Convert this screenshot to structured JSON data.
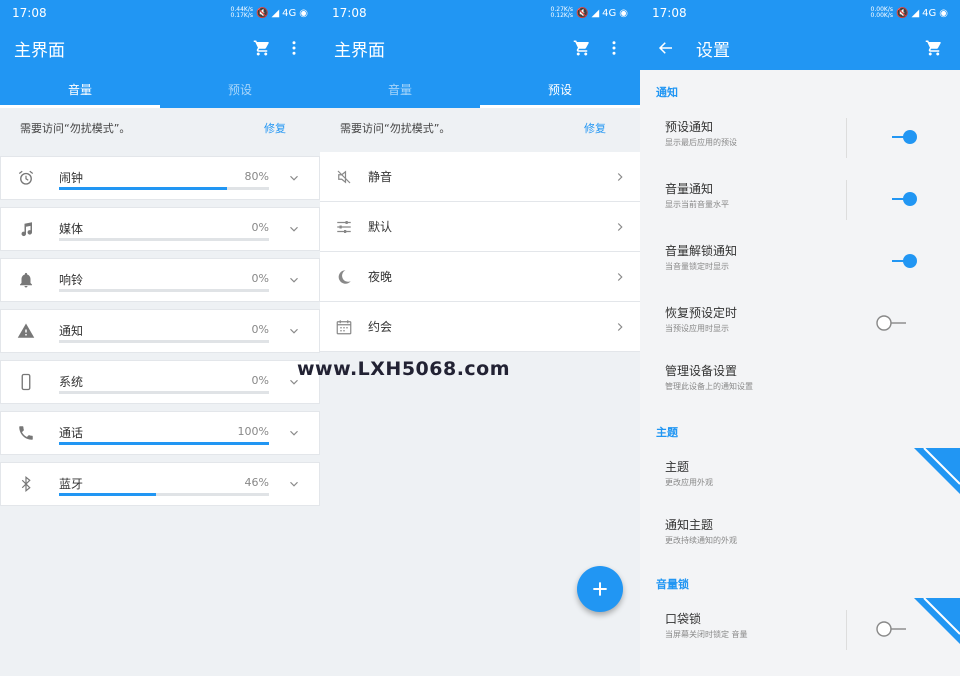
{
  "status": {
    "time": "17:08",
    "net_up": "0.44K/s",
    "net_down": "0.17K/s",
    "net_up_2": "0.27K/s",
    "net_down_2": "0.12K/s",
    "net_up_3": "0.00K/s",
    "net_down_3": "0.00K/s",
    "network": "4G"
  },
  "main": {
    "title": "主界面",
    "tabs": [
      {
        "label": "音量"
      },
      {
        "label": "预设"
      }
    ],
    "notice": "需要访问“勿扰模式”。",
    "fix_label": "修复",
    "volumes": [
      {
        "label": "闹钟",
        "percent": "80%",
        "level": 0.8,
        "icon": "alarm-clock-icon"
      },
      {
        "label": "媒体",
        "percent": "0%",
        "level": 0,
        "icon": "music-note-icon"
      },
      {
        "label": "响铃",
        "percent": "0%",
        "level": 0,
        "icon": "bell-icon"
      },
      {
        "label": "通知",
        "percent": "0%",
        "level": 0,
        "icon": "warning-icon"
      },
      {
        "label": "系统",
        "percent": "0%",
        "level": 0,
        "icon": "phone-device-icon"
      },
      {
        "label": "通话",
        "percent": "100%",
        "level": 1.0,
        "icon": "phone-call-icon"
      },
      {
        "label": "蓝牙",
        "percent": "46%",
        "level": 0.46,
        "icon": "bluetooth-icon"
      }
    ],
    "presets": [
      {
        "label": "静音",
        "icon": "mute-icon"
      },
      {
        "label": "默认",
        "icon": "sliders-icon"
      },
      {
        "label": "夜晚",
        "icon": "moon-icon"
      },
      {
        "label": "约会",
        "icon": "calendar-icon"
      }
    ]
  },
  "settings": {
    "title": "设置",
    "sections": {
      "notify": "通知",
      "theme": "主题",
      "volume_lock": "音量锁"
    },
    "items": {
      "preset_notify": {
        "title": "预设通知",
        "sub": "显示最后应用的预设",
        "on": true
      },
      "volume_notify": {
        "title": "音量通知",
        "sub": "显示当前音量水平",
        "on": true
      },
      "unlock_notify": {
        "title": "音量解锁通知",
        "sub": "当音量锁定时显示",
        "on": true
      },
      "restore": {
        "title": "恢复预设定时",
        "sub": "当预设应用时显示",
        "on": false
      },
      "manage": {
        "title": "管理设备设置",
        "sub": "管理此设备上的通知设置"
      },
      "theme": {
        "title": "主题",
        "sub": "更改应用外观"
      },
      "notify_theme": {
        "title": "通知主题",
        "sub": "更改持续通知的外观"
      },
      "pocket_lock": {
        "title": "口袋锁",
        "sub": "当屏幕关闭时锁定 音量",
        "on": false
      }
    }
  },
  "watermark": "www.LXH5068.com",
  "colors": {
    "primary": "#2196f3",
    "track": "#e0e3e6"
  }
}
